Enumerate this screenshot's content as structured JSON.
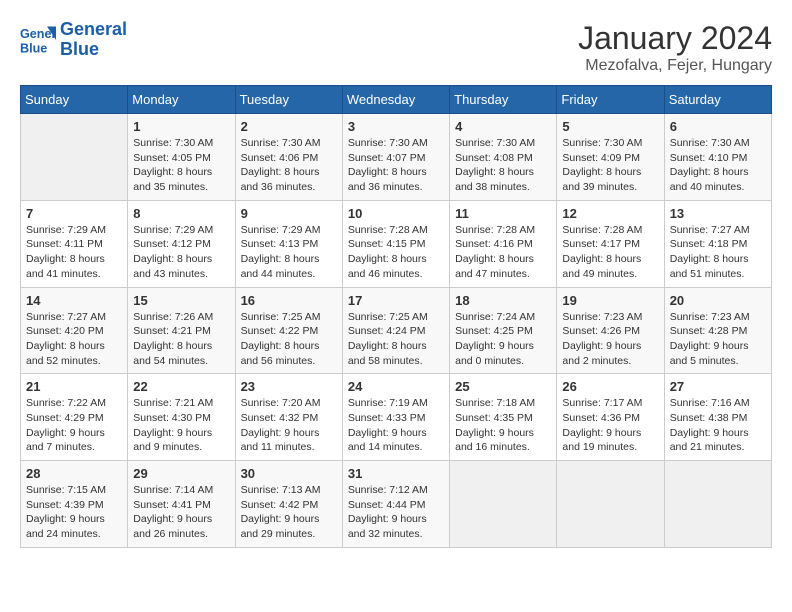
{
  "logo": {
    "line1": "General",
    "line2": "Blue"
  },
  "title": "January 2024",
  "location": "Mezofalva, Fejer, Hungary",
  "days_header": [
    "Sunday",
    "Monday",
    "Tuesday",
    "Wednesday",
    "Thursday",
    "Friday",
    "Saturday"
  ],
  "weeks": [
    [
      {
        "day": "",
        "info": ""
      },
      {
        "day": "1",
        "info": "Sunrise: 7:30 AM\nSunset: 4:05 PM\nDaylight: 8 hours\nand 35 minutes."
      },
      {
        "day": "2",
        "info": "Sunrise: 7:30 AM\nSunset: 4:06 PM\nDaylight: 8 hours\nand 36 minutes."
      },
      {
        "day": "3",
        "info": "Sunrise: 7:30 AM\nSunset: 4:07 PM\nDaylight: 8 hours\nand 36 minutes."
      },
      {
        "day": "4",
        "info": "Sunrise: 7:30 AM\nSunset: 4:08 PM\nDaylight: 8 hours\nand 38 minutes."
      },
      {
        "day": "5",
        "info": "Sunrise: 7:30 AM\nSunset: 4:09 PM\nDaylight: 8 hours\nand 39 minutes."
      },
      {
        "day": "6",
        "info": "Sunrise: 7:30 AM\nSunset: 4:10 PM\nDaylight: 8 hours\nand 40 minutes."
      }
    ],
    [
      {
        "day": "7",
        "info": "Sunrise: 7:29 AM\nSunset: 4:11 PM\nDaylight: 8 hours\nand 41 minutes."
      },
      {
        "day": "8",
        "info": "Sunrise: 7:29 AM\nSunset: 4:12 PM\nDaylight: 8 hours\nand 43 minutes."
      },
      {
        "day": "9",
        "info": "Sunrise: 7:29 AM\nSunset: 4:13 PM\nDaylight: 8 hours\nand 44 minutes."
      },
      {
        "day": "10",
        "info": "Sunrise: 7:28 AM\nSunset: 4:15 PM\nDaylight: 8 hours\nand 46 minutes."
      },
      {
        "day": "11",
        "info": "Sunrise: 7:28 AM\nSunset: 4:16 PM\nDaylight: 8 hours\nand 47 minutes."
      },
      {
        "day": "12",
        "info": "Sunrise: 7:28 AM\nSunset: 4:17 PM\nDaylight: 8 hours\nand 49 minutes."
      },
      {
        "day": "13",
        "info": "Sunrise: 7:27 AM\nSunset: 4:18 PM\nDaylight: 8 hours\nand 51 minutes."
      }
    ],
    [
      {
        "day": "14",
        "info": "Sunrise: 7:27 AM\nSunset: 4:20 PM\nDaylight: 8 hours\nand 52 minutes."
      },
      {
        "day": "15",
        "info": "Sunrise: 7:26 AM\nSunset: 4:21 PM\nDaylight: 8 hours\nand 54 minutes."
      },
      {
        "day": "16",
        "info": "Sunrise: 7:25 AM\nSunset: 4:22 PM\nDaylight: 8 hours\nand 56 minutes."
      },
      {
        "day": "17",
        "info": "Sunrise: 7:25 AM\nSunset: 4:24 PM\nDaylight: 8 hours\nand 58 minutes."
      },
      {
        "day": "18",
        "info": "Sunrise: 7:24 AM\nSunset: 4:25 PM\nDaylight: 9 hours\nand 0 minutes."
      },
      {
        "day": "19",
        "info": "Sunrise: 7:23 AM\nSunset: 4:26 PM\nDaylight: 9 hours\nand 2 minutes."
      },
      {
        "day": "20",
        "info": "Sunrise: 7:23 AM\nSunset: 4:28 PM\nDaylight: 9 hours\nand 5 minutes."
      }
    ],
    [
      {
        "day": "21",
        "info": "Sunrise: 7:22 AM\nSunset: 4:29 PM\nDaylight: 9 hours\nand 7 minutes."
      },
      {
        "day": "22",
        "info": "Sunrise: 7:21 AM\nSunset: 4:30 PM\nDaylight: 9 hours\nand 9 minutes."
      },
      {
        "day": "23",
        "info": "Sunrise: 7:20 AM\nSunset: 4:32 PM\nDaylight: 9 hours\nand 11 minutes."
      },
      {
        "day": "24",
        "info": "Sunrise: 7:19 AM\nSunset: 4:33 PM\nDaylight: 9 hours\nand 14 minutes."
      },
      {
        "day": "25",
        "info": "Sunrise: 7:18 AM\nSunset: 4:35 PM\nDaylight: 9 hours\nand 16 minutes."
      },
      {
        "day": "26",
        "info": "Sunrise: 7:17 AM\nSunset: 4:36 PM\nDaylight: 9 hours\nand 19 minutes."
      },
      {
        "day": "27",
        "info": "Sunrise: 7:16 AM\nSunset: 4:38 PM\nDaylight: 9 hours\nand 21 minutes."
      }
    ],
    [
      {
        "day": "28",
        "info": "Sunrise: 7:15 AM\nSunset: 4:39 PM\nDaylight: 9 hours\nand 24 minutes."
      },
      {
        "day": "29",
        "info": "Sunrise: 7:14 AM\nSunset: 4:41 PM\nDaylight: 9 hours\nand 26 minutes."
      },
      {
        "day": "30",
        "info": "Sunrise: 7:13 AM\nSunset: 4:42 PM\nDaylight: 9 hours\nand 29 minutes."
      },
      {
        "day": "31",
        "info": "Sunrise: 7:12 AM\nSunset: 4:44 PM\nDaylight: 9 hours\nand 32 minutes."
      },
      {
        "day": "",
        "info": ""
      },
      {
        "day": "",
        "info": ""
      },
      {
        "day": "",
        "info": ""
      }
    ]
  ]
}
